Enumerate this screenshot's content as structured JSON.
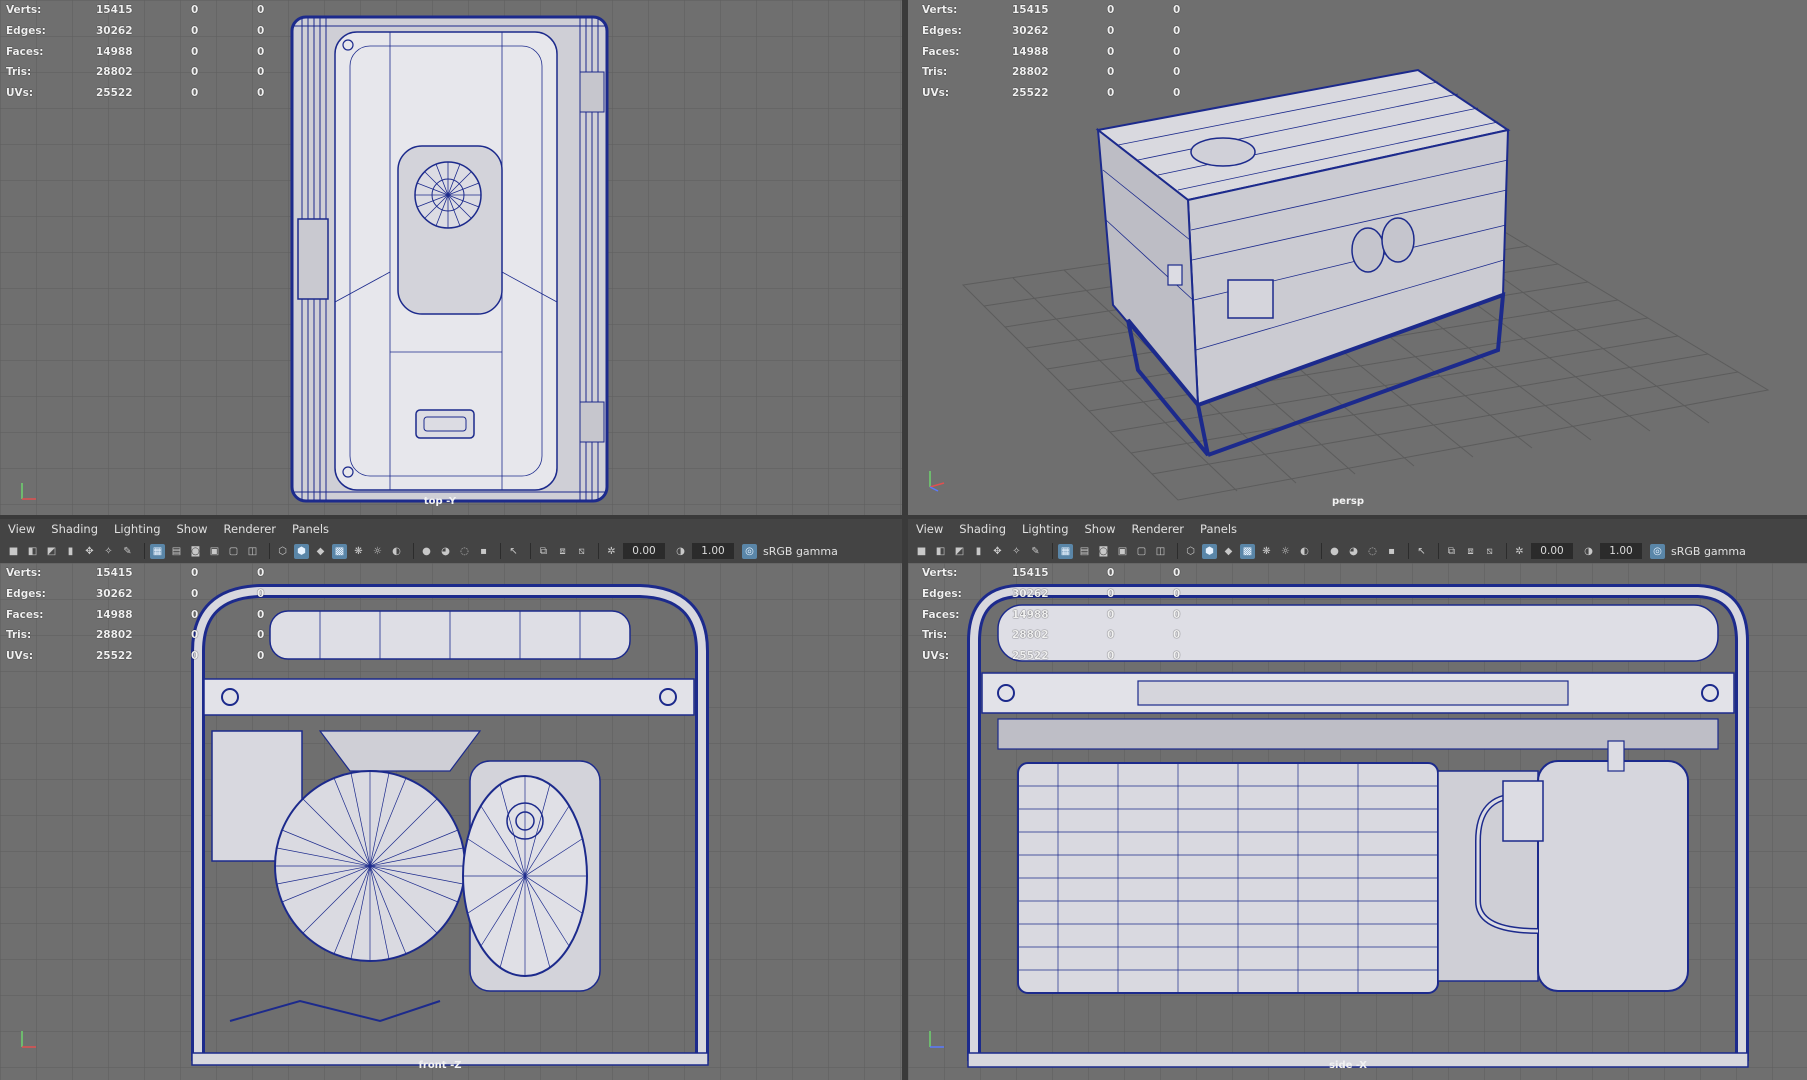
{
  "stats_labels": [
    "Verts:",
    "Edges:",
    "Faces:",
    "Tris:",
    "UVs:"
  ],
  "stats_values": [
    "15415",
    "30262",
    "14988",
    "28802",
    "25522"
  ],
  "stats_zero": "0",
  "viewports": {
    "top": {
      "camera": "top -Y"
    },
    "persp": {
      "camera": "persp"
    },
    "front": {
      "camera": "front -Z"
    },
    "side": {
      "camera": "side -X"
    }
  },
  "menu": [
    "View",
    "Shading",
    "Lighting",
    "Show",
    "Renderer",
    "Panels"
  ],
  "toolbar": {
    "exposure": "0.00",
    "gamma": "1.00",
    "color_space": "sRGB gamma"
  },
  "icons": [
    "camera-select-icon",
    "camera-attributes-icon",
    "bookmark-icon",
    "image-plane-icon",
    "grid-icon",
    "film-gate-icon",
    "resolution-gate-icon",
    "wireframe-icon",
    "smooth-shade-icon",
    "textured-icon",
    "lights-icon",
    "shadows-icon",
    "ambient-occlusion-icon",
    "isolate-select-icon",
    "xray-icon",
    "exposure-icon",
    "gamma-icon",
    "color-management-icon"
  ],
  "colors": {
    "viewport_bg": "#6f6f6f",
    "grid": "#5f5f5f",
    "wire": "#1c2a8c",
    "panel_bg": "#444444"
  }
}
